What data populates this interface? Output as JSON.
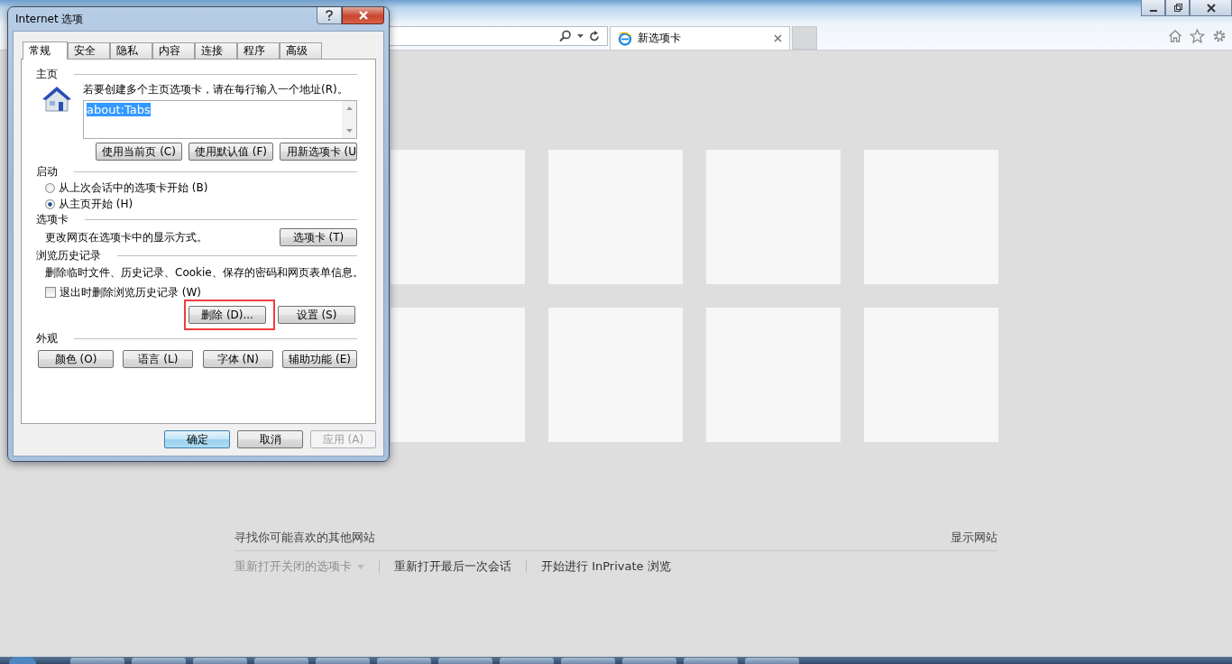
{
  "browser": {
    "tab": {
      "title": "新选项卡"
    },
    "footer": {
      "discover": "寻找你可能喜欢的其他网站",
      "show_sites": "显示网站",
      "links": [
        {
          "label": "重新打开关闭的选项卡",
          "disabled": true,
          "dropdown": true
        },
        {
          "label": "重新打开最后一次会话",
          "disabled": false,
          "dropdown": false
        },
        {
          "label": "开始进行 InPrivate 浏览",
          "disabled": false,
          "dropdown": false
        }
      ]
    }
  },
  "dialog": {
    "title": "Internet 选项",
    "tabs": [
      {
        "label": "常规",
        "selected": true
      },
      {
        "label": "安全",
        "selected": false
      },
      {
        "label": "隐私",
        "selected": false
      },
      {
        "label": "内容",
        "selected": false
      },
      {
        "label": "连接",
        "selected": false
      },
      {
        "label": "程序",
        "selected": false
      },
      {
        "label": "高级",
        "selected": false
      }
    ],
    "home_page": {
      "heading": "主页",
      "instruction": "若要创建多个主页选项卡，请在每行输入一个地址(R)。",
      "value": "about:Tabs",
      "buttons": [
        "使用当前页 (C)",
        "使用默认值 (F)",
        "用新选项卡 (U"
      ]
    },
    "startup": {
      "heading": "启动",
      "options": [
        {
          "label": "从上次会话中的选项卡开始 (B)",
          "selected": false
        },
        {
          "label": "从主页开始 (H)",
          "selected": true
        }
      ]
    },
    "tabs_section": {
      "heading": "选项卡",
      "description": "更改网页在选项卡中的显示方式。",
      "button": "选项卡 (T)"
    },
    "history": {
      "heading": "浏览历史记录",
      "description": "删除临时文件、历史记录、Cookie、保存的密码和网页表单信息。",
      "checkbox": {
        "label": "退出时删除浏览历史记录 (W)",
        "checked": false
      },
      "buttons": [
        {
          "label": "删除 (D)...",
          "highlighted": true
        },
        {
          "label": "设置 (S)",
          "highlighted": false
        }
      ]
    },
    "appearance": {
      "heading": "外观",
      "buttons": [
        "颜色 (O)",
        "语言 (L)",
        "字体 (N)",
        "辅助功能 (E)"
      ]
    },
    "footer_buttons": [
      {
        "label": "确定",
        "default": true,
        "disabled": false
      },
      {
        "label": "取消",
        "default": false,
        "disabled": false
      },
      {
        "label": "应用 (A)",
        "default": false,
        "disabled": true
      }
    ]
  }
}
